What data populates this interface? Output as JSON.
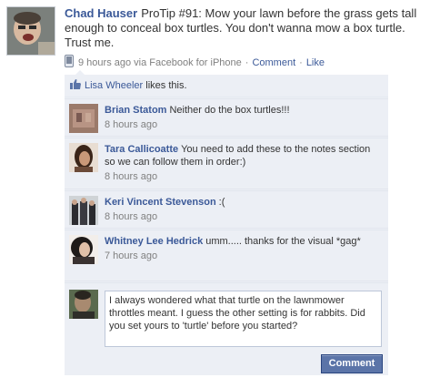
{
  "post": {
    "author": "Chad Hauser",
    "text": "ProTip #91: Mow your lawn before the grass gets tall enough to conceal box turtles. You don't wanna mow a box turtle. Trust me.",
    "time": "9 hours ago via Facebook for iPhone",
    "comment_link": "Comment",
    "like_link": "Like",
    "separator": "·",
    "device_icon": "phone-icon"
  },
  "likes": {
    "name": "Lisa Wheeler",
    "suffix": "likes this.",
    "icon": "thumbs-up-icon"
  },
  "comments": [
    {
      "author": "Brian Statom",
      "text": "Neither do the box turtles!!!",
      "time": "8 hours ago"
    },
    {
      "author": "Tara Callicoatte",
      "text": "You need to add these to the notes section so we can follow them in order:)",
      "time": "8 hours ago"
    },
    {
      "author": "Keri Vincent Stevenson",
      "text": ":(",
      "time": "8 hours ago"
    },
    {
      "author": "Whitney Lee Hedrick",
      "text": "umm..... thanks for the visual *gag*",
      "time": "7 hours ago"
    }
  ],
  "composer": {
    "value": "I always wondered what that turtle on the lawnmower throttles meant. I guess the other setting is for rabbits. Did you set yours to 'turtle' before you started?",
    "button": "Comment"
  },
  "colors": {
    "link": "#3b5998",
    "feedback_bg": "#eceff5",
    "button_bg": "#5b74a8",
    "meta_gray": "#808080"
  }
}
